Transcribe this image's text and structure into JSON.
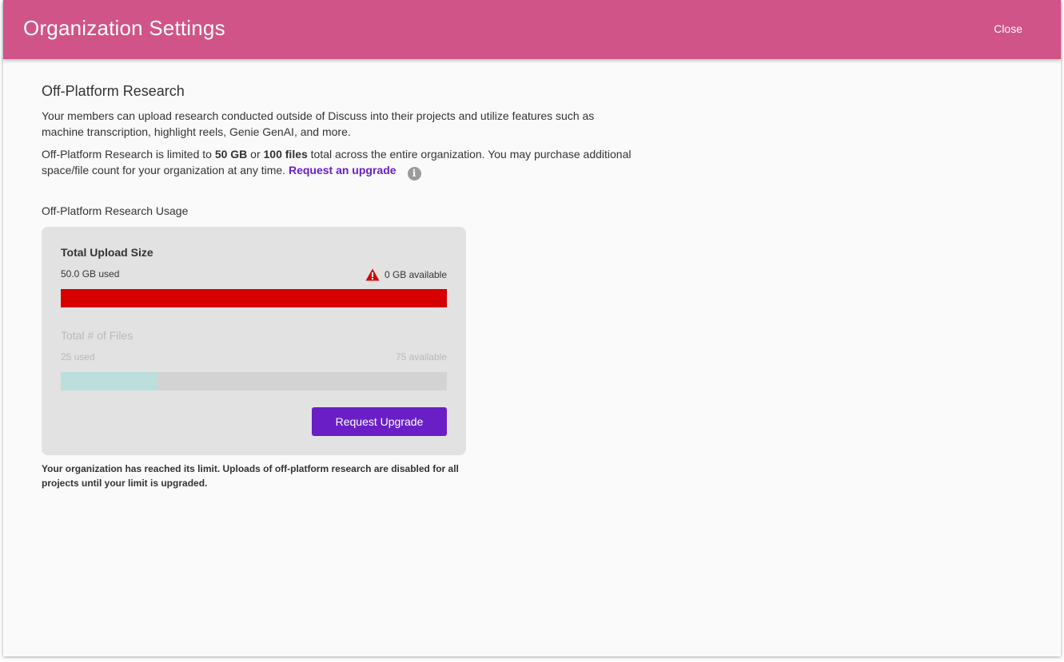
{
  "header": {
    "title": "Organization Settings",
    "close_label": "Close",
    "color": "#d05487"
  },
  "section": {
    "title": "Off-Platform Research",
    "description": "Your members can upload research conducted outside of Discuss into their projects and utilize features such as machine transcription, highlight reels, Genie GenAI, and more.",
    "limit_prefix": "Off-Platform Research is limited to ",
    "limit_size": "50 GB",
    "limit_or": " or ",
    "limit_files": "100 files",
    "limit_suffix": " total across the entire organization. You may purchase additional space/file count for your organization at any time. ",
    "request_link": "Request an upgrade",
    "info_icon": "info-icon"
  },
  "usage": {
    "title": "Off-Platform Research Usage",
    "upload_size": {
      "title": "Total Upload Size",
      "used": "50.0 GB used",
      "available": "0 GB available",
      "warning_icon": "warning-triangle-icon",
      "fill_fraction": 1.0,
      "color": "#d60000"
    },
    "file_count": {
      "title": "Total # of Files",
      "used": "25 used",
      "available": "75 available",
      "fill_fraction": 0.25,
      "color": "#bcdedd"
    },
    "upgrade_button": "Request Upgrade",
    "accent_color": "#6a1fc6"
  },
  "limit_note": "Your organization has reached its limit. Uploads of off-platform research are disabled for all projects until your limit is upgraded."
}
